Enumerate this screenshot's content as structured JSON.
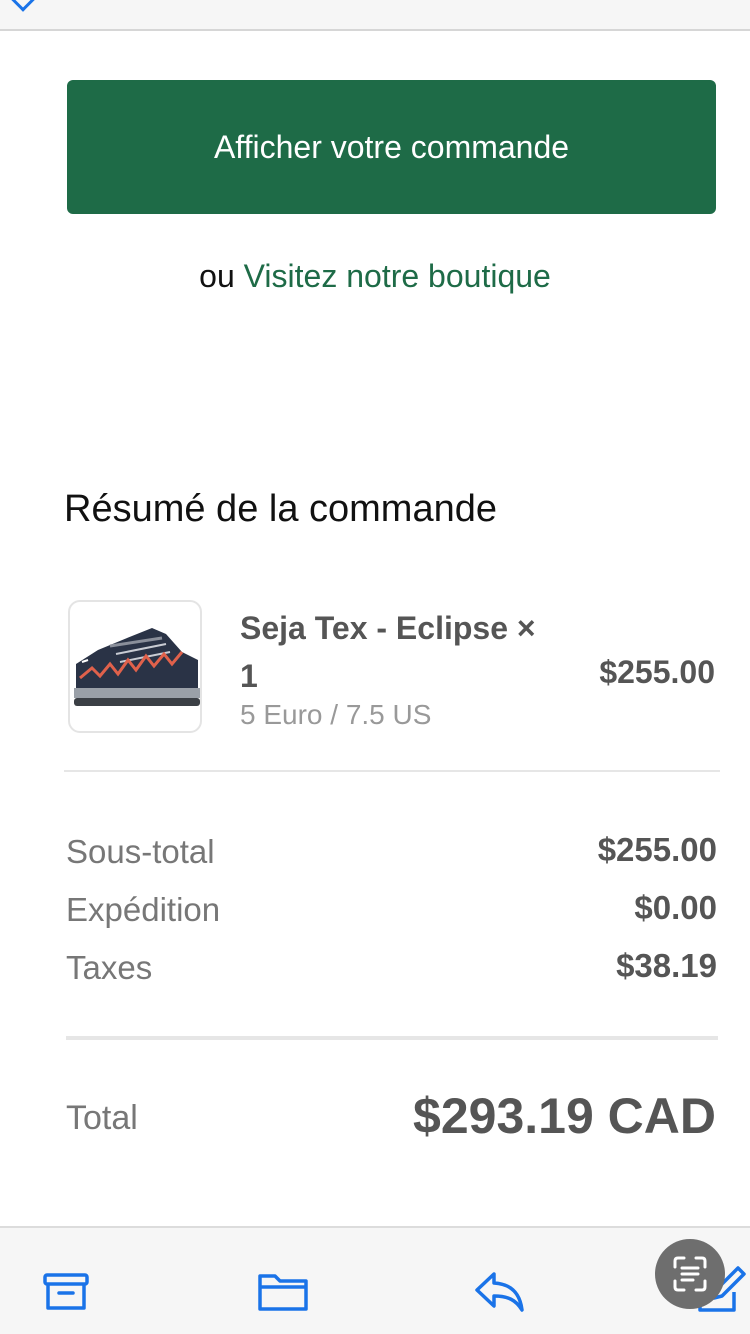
{
  "actions": {
    "view_order_label": "Afficher votre commande",
    "or_text": "ou",
    "visit_store_label": "Visitez notre boutique"
  },
  "summary": {
    "title": "Résumé de la commande",
    "item": {
      "name": "Seja Tex - Eclipse × 1",
      "variant": "5 Euro / 7.5 US",
      "price": "$255.00"
    },
    "lines": [
      {
        "label": "Sous-total",
        "value": "$255.00"
      },
      {
        "label": "Expédition",
        "value": "$0.00"
      },
      {
        "label": "Taxes",
        "value": "$38.19"
      }
    ],
    "total": {
      "label": "Total",
      "value": "$293.19 CAD"
    }
  },
  "toolbar": {
    "icons": [
      "archive-icon",
      "folder-icon",
      "reply-icon",
      "compose-icon"
    ],
    "accent": "#1a73e8"
  },
  "colors": {
    "brand": "#1e6b47"
  }
}
